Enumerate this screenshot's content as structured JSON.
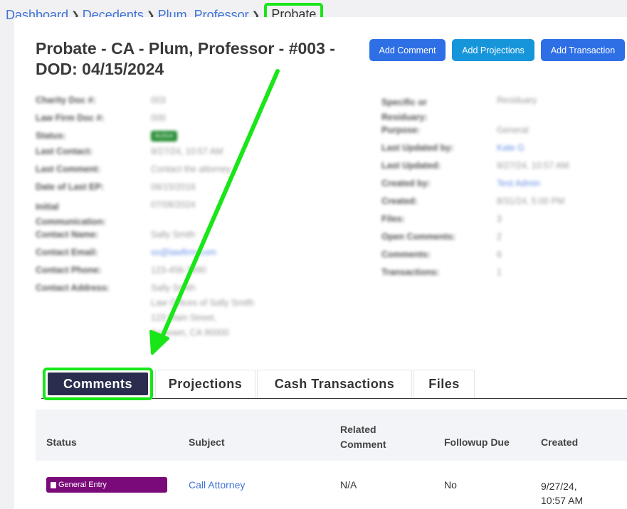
{
  "breadcrumb": {
    "items": [
      "Dashboard",
      "Decedents",
      "Plum, Professor"
    ],
    "current": "Probate"
  },
  "page": {
    "title": "Probate - CA - Plum, Professor - #003 - DOD: 04/15/2024"
  },
  "actions": {
    "add_comment": "Add Comment",
    "add_projections": "Add Projections",
    "add_transaction": "Add Transaction"
  },
  "details_left": [
    {
      "label": "Charity Doc #:",
      "value": "003"
    },
    {
      "label": "Law Firm Doc #:",
      "value": "000"
    },
    {
      "label": "Status:",
      "value": "Active"
    },
    {
      "label": "Last Contact:",
      "value": "9/27/24, 10:57 AM"
    },
    {
      "label": "Last Comment:",
      "value": "Contact the attorney"
    },
    {
      "label": "Date of Last EP:",
      "value": "06/15/2016"
    },
    {
      "label": "Initial Communication:",
      "value": "07/08/2024"
    },
    {
      "label": "Contact Name:",
      "value": "Sally Smith"
    },
    {
      "label": "Contact Email:",
      "value": "ss@lawfirm.com"
    },
    {
      "label": "Contact Phone:",
      "value": "123-456-7890"
    },
    {
      "label": "Contact Address:",
      "value": "Sally Smith",
      "value2": "Law Offices of Sally Smith",
      "value3": "123 Main Street,",
      "value4": "Anytown, CA 90000"
    }
  ],
  "details_right": [
    {
      "label": "Specific or Residuary:",
      "value": "Residuary"
    },
    {
      "label": "Purpose:",
      "value": "General"
    },
    {
      "label": "Last Updated by:",
      "value": "Kate G"
    },
    {
      "label": "Last Updated:",
      "value": "9/27/24, 10:57 AM"
    },
    {
      "label": "Created by:",
      "value": "Test Admin"
    },
    {
      "label": "Created:",
      "value": "8/31/24, 5:00 PM"
    },
    {
      "label": "Files:",
      "value": "3"
    },
    {
      "label": "Open Comments:",
      "value": "2"
    },
    {
      "label": "Comments:",
      "value": "6"
    },
    {
      "label": "Transactions:",
      "value": "1"
    }
  ],
  "tabs": [
    {
      "label": "Comments"
    },
    {
      "label": "Projections"
    },
    {
      "label": "Cash Transactions"
    },
    {
      "label": "Files"
    }
  ],
  "table": {
    "headers": {
      "status": "Status",
      "subject": "Subject",
      "related_1": "Related",
      "related_2": "Comment",
      "followup": "Followup Due",
      "created": "Created"
    },
    "rows": [
      {
        "status": "General Entry",
        "subject": "Call Attorney",
        "related": "N/A",
        "followup": "No",
        "created_1": "9/27/24,",
        "created_2": "10:57 AM"
      }
    ]
  },
  "colors": {
    "accent_blue": "#2e6fe6",
    "projections_blue": "#1795db",
    "highlight_green": "#19e619",
    "active_tab": "#2b2d4e",
    "entry_badge": "#7a0a7a"
  }
}
